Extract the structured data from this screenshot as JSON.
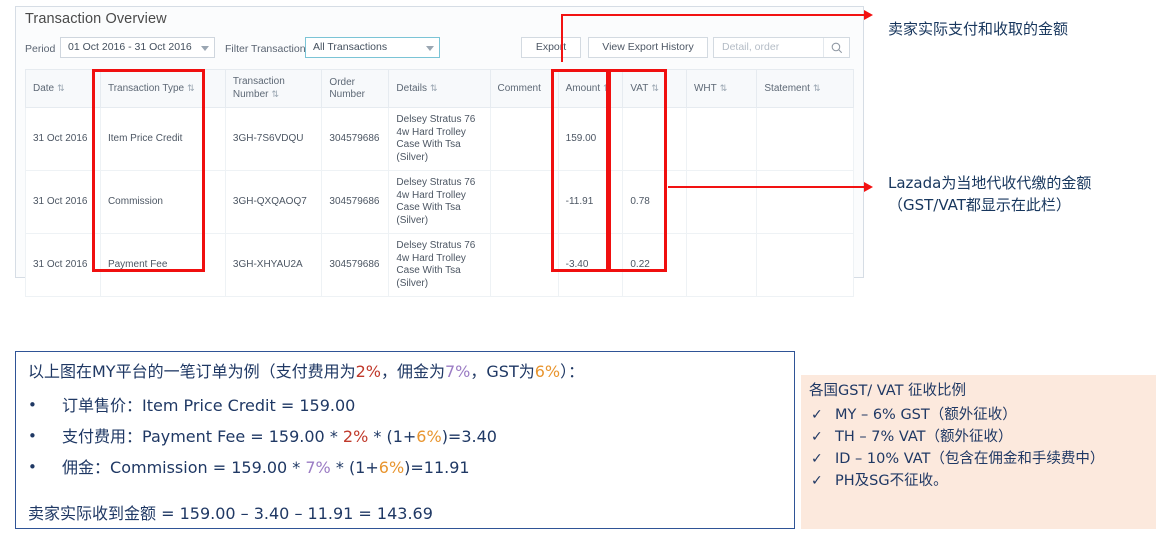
{
  "panel": {
    "title": "Transaction Overview",
    "toolbar": {
      "period_label": "Period",
      "period_value": "01 Oct 2016 - 31 Oct 2016",
      "filter_label": "Filter Transaction",
      "filter_value": "All Transactions",
      "export_label": "Export",
      "view_export_history_label": "View Export History",
      "search_placeholder": "Detail, order",
      "search_icon": "search-icon",
      "caret_icon": "chevron-down-icon"
    },
    "table": {
      "sort_icon": "sort-updown-icon",
      "columns": [
        {
          "key": "date",
          "label": "Date",
          "sortable": true
        },
        {
          "key": "transaction_type",
          "label": "Transaction Type",
          "sortable": true
        },
        {
          "key": "transaction_number",
          "label": "Transaction Number",
          "sortable": true
        },
        {
          "key": "order_number",
          "label": "Order Number",
          "sortable": false
        },
        {
          "key": "details",
          "label": "Details",
          "sortable": true
        },
        {
          "key": "comment",
          "label": "Comment",
          "sortable": false
        },
        {
          "key": "amount",
          "label": "Amount",
          "sortable": true
        },
        {
          "key": "vat",
          "label": "VAT",
          "sortable": true
        },
        {
          "key": "wht",
          "label": "WHT",
          "sortable": true
        },
        {
          "key": "statement",
          "label": "Statement",
          "sortable": true
        }
      ],
      "rows": [
        {
          "date": "31 Oct 2016",
          "transaction_type": "Item Price Credit",
          "transaction_number": "3GH-7S6VDQU",
          "order_number": "304579686",
          "details": "Delsey Stratus 76 4w Hard Trolley Case With Tsa (Silver)",
          "comment": "",
          "amount": "159.00",
          "vat": "",
          "wht": "",
          "statement": ""
        },
        {
          "date": "31 Oct 2016",
          "transaction_type": "Commission",
          "transaction_number": "3GH-QXQAOQ7",
          "order_number": "304579686",
          "details": "Delsey Stratus 76 4w Hard Trolley Case With Tsa (Silver)",
          "comment": "",
          "amount": "-11.91",
          "vat": "0.78",
          "wht": "",
          "statement": ""
        },
        {
          "date": "31 Oct 2016",
          "transaction_type": "Payment Fee",
          "transaction_number": "3GH-XHYAU2A",
          "order_number": "304579686",
          "details": "Delsey Stratus 76 4w Hard Trolley Case With Tsa (Silver)",
          "comment": "",
          "amount": "-3.40",
          "vat": "0.22",
          "wht": "",
          "statement": ""
        }
      ]
    }
  },
  "annotations": {
    "accent_color": "#f21212",
    "callout_amount": "卖家实际支付和收取的金额",
    "callout_vat": "Lazada为当地代收代缴的金额\n（GST/VAT都显示在此栏）"
  },
  "explanation": {
    "intro_a": "以上图在MY平台的一笔订单为例（支付费用为",
    "intro_pct_payment": "2%",
    "intro_b": "，佣金为",
    "intro_pct_commission": "7%",
    "intro_c": "，GST为",
    "intro_pct_gst": "6%",
    "intro_d": "）：",
    "bullet1_label": "订单售价：",
    "bullet1_formula": "Item Price Credit = 159.00",
    "bullet2_label": "支付费用：",
    "bullet2_a": "Payment Fee = 159.00 * ",
    "bullet2_pct": "2%",
    "bullet2_b": " * (1+",
    "bullet2_gst": "6%",
    "bullet2_c": ")=3.40",
    "bullet3_label": "佣金：",
    "bullet3_a": "Commission = 159.00 * ",
    "bullet3_pct": "7%",
    "bullet3_b": " * (1+",
    "bullet3_gst": "6%",
    "bullet3_c": ")=11.91",
    "total": "卖家实际收到金额 = 159.00 – 3.40 – 11.91 = 143.69"
  },
  "vat_rates": {
    "title": "各国GST/ VAT 征收比例",
    "check_icon": "check-icon",
    "items": [
      "MY – 6% GST（额外征收）",
      "TH – 7% VAT（额外征收）",
      "ID – 10% VAT（包含在佣金和手续费中）",
      "PH及SG不征收。"
    ]
  }
}
